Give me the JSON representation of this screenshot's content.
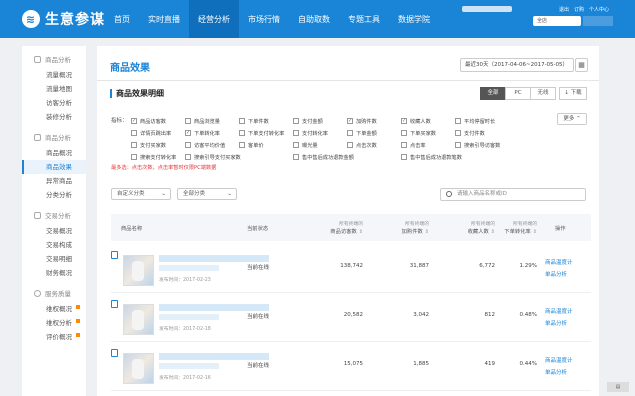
{
  "app": {
    "name": "生意参谋",
    "logo_glyph": "≋"
  },
  "nav": {
    "items": [
      {
        "label": "首页"
      },
      {
        "label": "实时直播"
      },
      {
        "label": "经营分析",
        "active": true
      },
      {
        "label": "市场行情"
      },
      {
        "label": "自助取数"
      },
      {
        "label": "专题工具"
      },
      {
        "label": "数据学院"
      }
    ],
    "user_links": [
      "退出",
      "订购",
      "个人中心"
    ],
    "store_input": "全店"
  },
  "sidebar": {
    "groups": [
      {
        "label": "商品分析",
        "icon": "chart-icon",
        "items": [
          {
            "label": "流量概况"
          },
          {
            "label": "流量地图"
          },
          {
            "label": "访客分析"
          },
          {
            "label": "装修分析"
          }
        ]
      },
      {
        "label": "商品分析",
        "icon": "box-icon",
        "items": [
          {
            "label": "商品概况"
          },
          {
            "label": "商品效果",
            "active": true
          },
          {
            "label": "异常商品"
          },
          {
            "label": "分类分析"
          }
        ]
      },
      {
        "label": "交易分析",
        "icon": "cart-icon",
        "items": [
          {
            "label": "交易概况"
          },
          {
            "label": "交易构成"
          },
          {
            "label": "交易明细"
          },
          {
            "label": "财务概况"
          }
        ]
      },
      {
        "label": "服务质量",
        "icon": "service-icon",
        "items": [
          {
            "label": "维权概况",
            "badge": true
          },
          {
            "label": "维权分析",
            "badge": true
          },
          {
            "label": "评价概况",
            "badge": true
          }
        ]
      }
    ]
  },
  "main": {
    "title": "商品效果",
    "date_range": "最近30天（2017-04-06~2017-05-05）",
    "section_title": "商品效果明细",
    "device_tabs": [
      {
        "label": "全部",
        "active": true
      },
      {
        "label": "PC"
      },
      {
        "label": "无线"
      }
    ],
    "download": "下载",
    "metrics_label": "指标：",
    "more": "更多",
    "metrics": [
      {
        "label": "商品访客数",
        "checked": true
      },
      {
        "label": "商品浏览量"
      },
      {
        "label": "下单件数"
      },
      {
        "label": "支付金额"
      },
      {
        "label": "加购件数",
        "checked": true
      },
      {
        "label": "收藏人数",
        "checked": true
      },
      {
        "label": "平均停留时长"
      },
      {
        "label": ""
      },
      {
        "label": "详情页跳出率"
      },
      {
        "label": "下单转化率",
        "checked": true
      },
      {
        "label": "下单支付转化率"
      },
      {
        "label": "支付转化率"
      },
      {
        "label": "下单金额"
      },
      {
        "label": "下单买家数"
      },
      {
        "label": "支付件数"
      },
      {
        "label": ""
      },
      {
        "label": "支付买家数"
      },
      {
        "label": "访客平均价值"
      },
      {
        "label": "客单价"
      },
      {
        "label": "曝光量"
      },
      {
        "label": "点击次数"
      },
      {
        "label": "点击率"
      },
      {
        "label": "搜索引导访客数"
      },
      {
        "label": ""
      },
      {
        "label": "搜索支付转化率"
      },
      {
        "label": "搜索引导支付买家数"
      },
      {
        "label": ""
      },
      {
        "label": "售中售后成功退款金额"
      },
      {
        "label": ""
      },
      {
        "label": "售中售后成功退款笔数"
      },
      {
        "label": ""
      },
      {
        "label": ""
      }
    ],
    "warning": "最多选：点击次数，点击率暂时仅限PC端数据",
    "filter_category": "自定义分类",
    "filter_all": "全部分类",
    "search_placeholder": "请输入商品名称或ID",
    "columns": {
      "name": "商品名称",
      "status": "当前状态",
      "visitors_sub": "所有终端的",
      "visitors": "商品访客数",
      "cart_sub": "所有终端的",
      "cart": "加购件数",
      "fav_sub": "所有终端的",
      "fav": "收藏人数",
      "conv_sub": "所有终端的",
      "conv": "下单转化率",
      "op": "操作"
    },
    "rows": [
      {
        "time": "发布时间：2017-02-23",
        "status": "当前在线",
        "visitors": "138,742",
        "cart": "31,887",
        "fav": "6,772",
        "conv": "1.29%",
        "op1": "商品温度计",
        "op2": "单品分析"
      },
      {
        "time": "发布时间：2017-02-18",
        "status": "当前在线",
        "visitors": "20,582",
        "cart": "3,042",
        "fav": "812",
        "conv": "0.48%",
        "op1": "商品温度计",
        "op2": "单品分析"
      },
      {
        "time": "发布时间：2017-02-16",
        "status": "当前在线",
        "visitors": "15,075",
        "cart": "1,885",
        "fav": "419",
        "conv": "0.44%",
        "op1": "商品温度计",
        "op2": "单品分析"
      }
    ]
  },
  "colors": {
    "brand": "#1a84d6",
    "warning": "#e4393c",
    "badge": "#ff8a00"
  }
}
